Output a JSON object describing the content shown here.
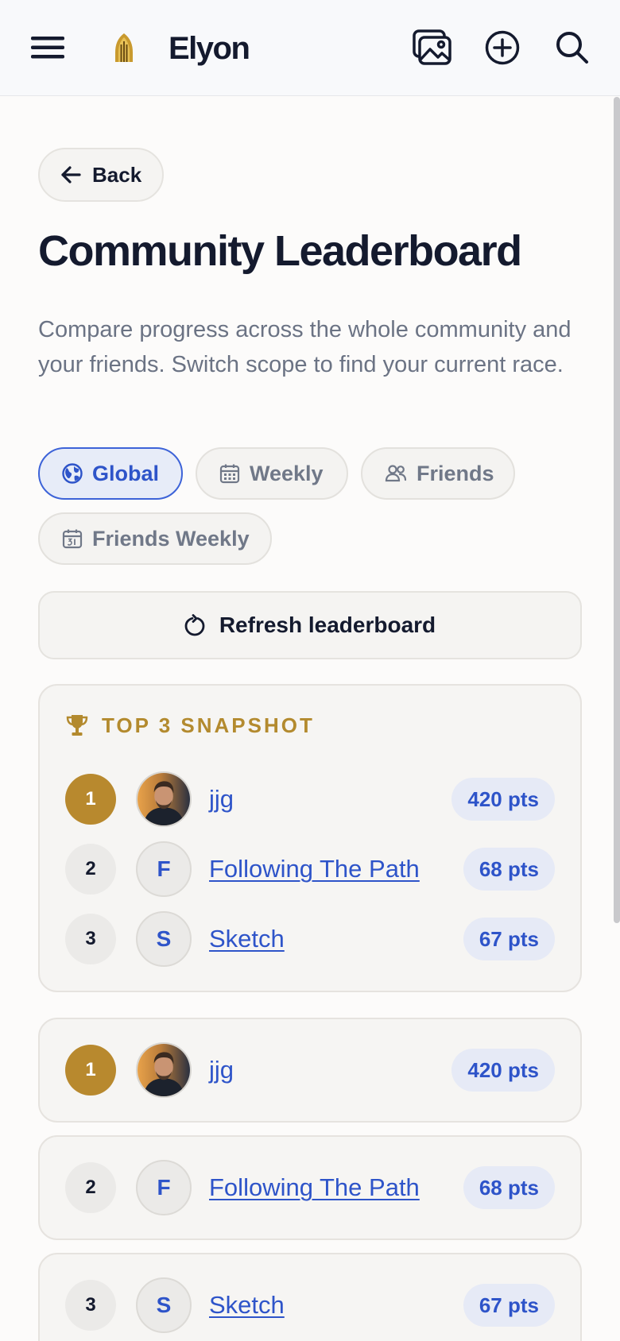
{
  "app": {
    "brand": "Elyon"
  },
  "header": {
    "icons": [
      "menu-icon",
      "logo-icon",
      "gallery-icon",
      "add-circle-icon",
      "search-icon"
    ]
  },
  "back": {
    "label": "Back"
  },
  "page": {
    "title": "Community Leaderboard",
    "description": "Compare progress across the whole community and your friends. Switch scope to find your current race."
  },
  "scopes": [
    {
      "label": "Global",
      "icon": "globe-icon",
      "active": true
    },
    {
      "label": "Weekly",
      "icon": "calendar-icon",
      "active": false
    },
    {
      "label": "Friends",
      "icon": "users-icon",
      "active": false
    },
    {
      "label": "Friends Weekly",
      "icon": "calendar-31-icon",
      "active": false
    }
  ],
  "refresh": {
    "label": "Refresh leaderboard"
  },
  "snapshot": {
    "title": "TOP 3 SNAPSHOT",
    "entries": [
      {
        "rank": "1",
        "initial": "",
        "name": "jjg",
        "points": "420 pts"
      },
      {
        "rank": "2",
        "initial": "F",
        "name": "Following The Path",
        "points": "68 pts"
      },
      {
        "rank": "3",
        "initial": "S",
        "name": "Sketch",
        "points": "67 pts"
      }
    ]
  },
  "leaderboard": [
    {
      "rank": "1",
      "initial": "",
      "name": "jjg",
      "points": "420 pts"
    },
    {
      "rank": "2",
      "initial": "F",
      "name": "Following The Path",
      "points": "68 pts"
    },
    {
      "rank": "3",
      "initial": "S",
      "name": "Sketch",
      "points": "67 pts"
    }
  ],
  "colors": {
    "accent": "#2e54c9",
    "gold": "#b8892e",
    "text": "#141a2e",
    "muted": "#6b7384"
  }
}
